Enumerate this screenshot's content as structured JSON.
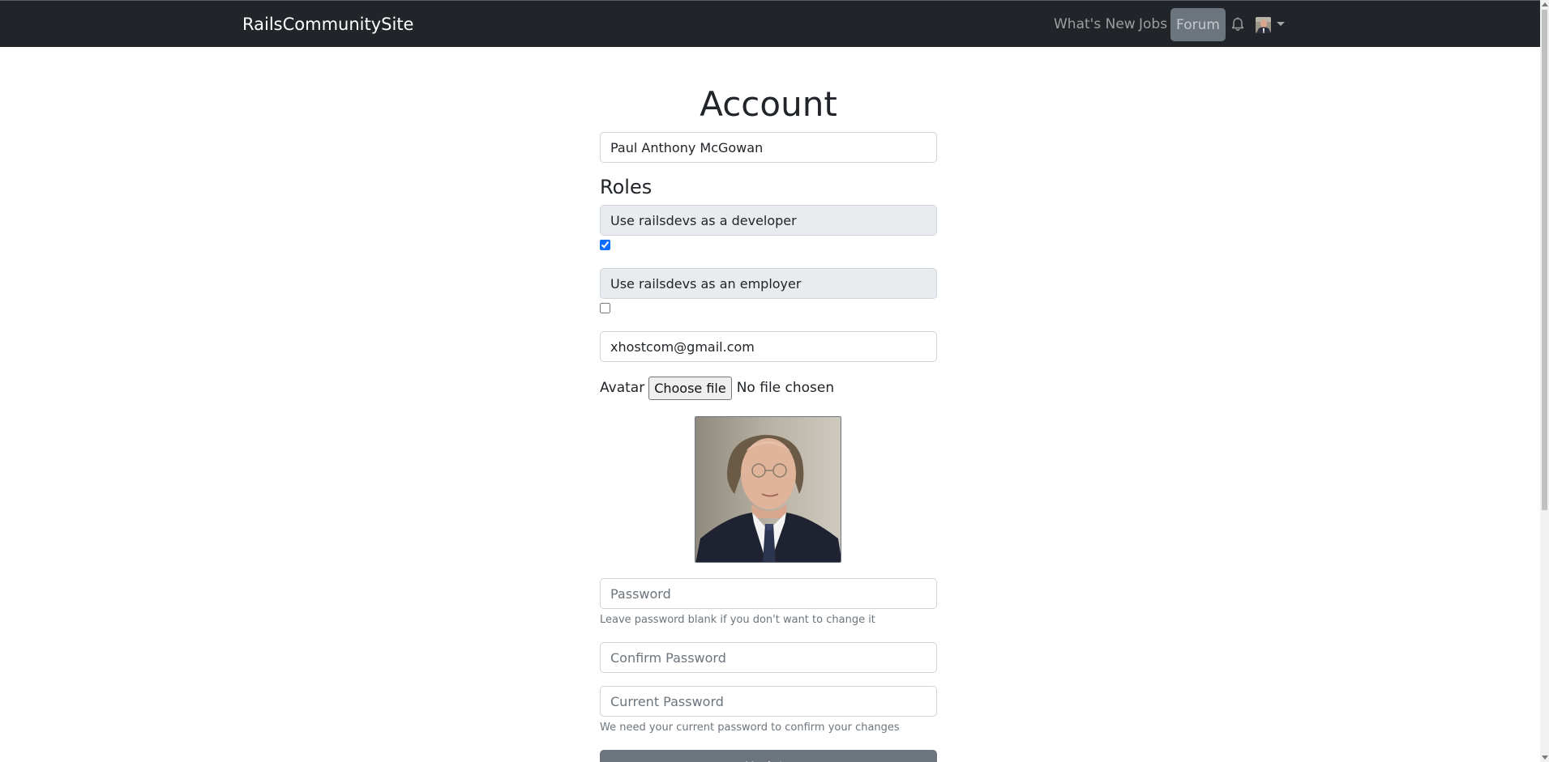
{
  "navbar": {
    "brand": "RailsCommunitySite",
    "links": {
      "whats_new": "What's New",
      "jobs": "Jobs",
      "forum": "Forum"
    },
    "active_link": "forum"
  },
  "account": {
    "title": "Account",
    "name_value": "Paul Anthony McGowan",
    "roles_heading": "Roles",
    "roles": [
      {
        "label": "Use railsdevs as a developer",
        "checked": true
      },
      {
        "label": "Use railsdevs as an employer",
        "checked": false
      }
    ],
    "email_value": "xhostcom@gmail.com",
    "avatar_label": "Avatar",
    "file_button": "Choose file",
    "file_status": "No file chosen",
    "password_placeholder": "Password",
    "password_help": "Leave password blank if you don't want to change it",
    "confirm_password_placeholder": "Confirm Password",
    "current_password_placeholder": "Current Password",
    "current_password_help": "We need your current password to confirm your changes",
    "submit_label": "Update"
  },
  "colors": {
    "navbar_bg": "#212529",
    "active_pill": "#6c757d",
    "checkbox_accent": "#0d6efd",
    "role_label_bg": "#e9ecef"
  },
  "icons": [
    "bell-icon",
    "user-avatar-icon",
    "caret-down-icon"
  ]
}
